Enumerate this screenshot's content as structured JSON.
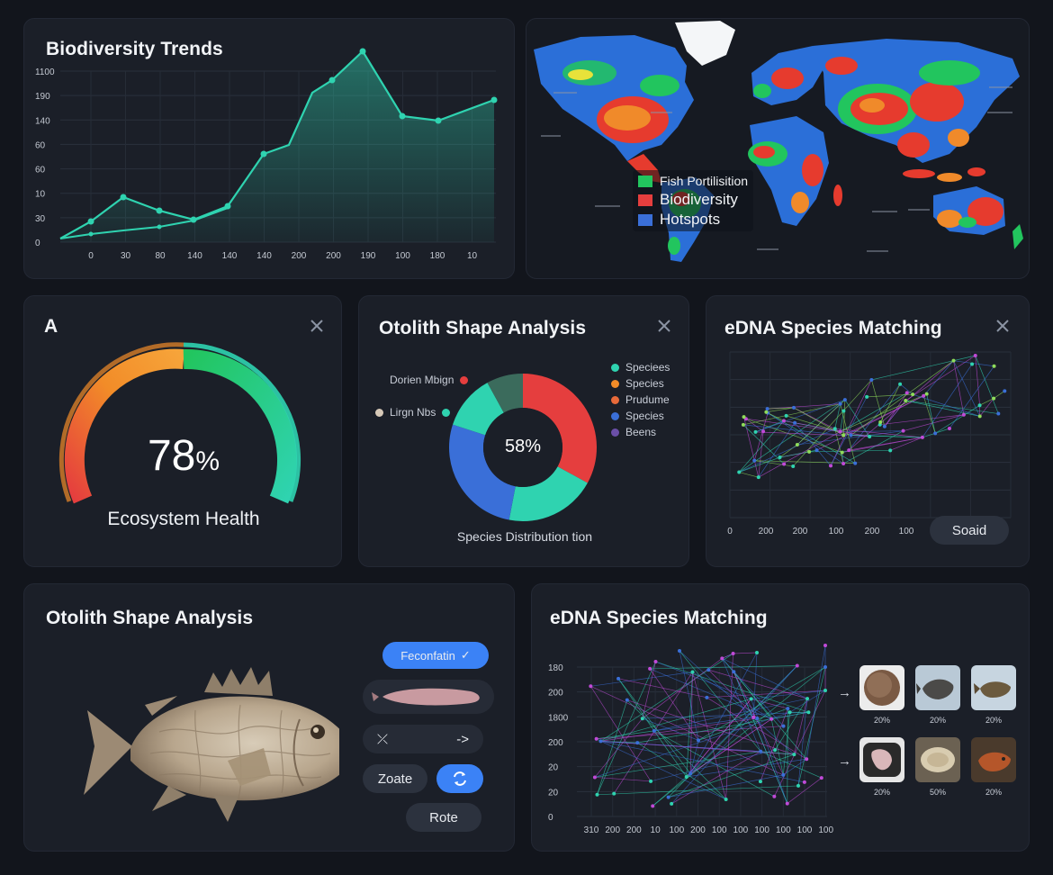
{
  "colors": {
    "background": "#12151c",
    "panel": "#1b1f28",
    "teal": "#2fd3b0",
    "green": "#22c55e",
    "red": "#e53e3e",
    "blue": "#3a6fd8",
    "orange": "#f28c28",
    "accent_button": "#3b82f6"
  },
  "trends": {
    "title": "Biodiversity Trends",
    "chart_data": {
      "type": "line",
      "y_ticks": [
        "1100",
        "190",
        "140",
        "60",
        "60",
        "10",
        "30",
        "0"
      ],
      "x_ticks": [
        "0",
        "30",
        "80",
        "140",
        "140",
        "140",
        "200",
        "200",
        "190",
        "100",
        "180",
        "10"
      ]
    }
  },
  "map": {
    "legend": [
      {
        "label": "Fish Portilisition",
        "color": "#22c55e"
      },
      {
        "label": "Biodiversity",
        "color": "#e53e3e"
      },
      {
        "label": "Hotspots",
        "color": "#3a6fd8"
      }
    ]
  },
  "health": {
    "title": "A",
    "value": "78",
    "unit": "%",
    "label": "Ecosystem Health",
    "gauge_fraction": 0.78
  },
  "otolith_donut": {
    "title": "Otolith Shape Analysis",
    "center_value": "58%",
    "caption": "Species Distribution tion",
    "left_labels": [
      {
        "label": "Dorien Mbign",
        "color": "#e53e3e"
      },
      {
        "label": "Lirgn Nbs",
        "color": "#2fd3b0"
      }
    ],
    "legend": [
      {
        "label": "Speciees",
        "color": "#2fd3b0"
      },
      {
        "label": "Species",
        "color": "#f28c28"
      },
      {
        "label": "Prudume",
        "color": "#e86a3a"
      },
      {
        "label": "Species",
        "color": "#3a6fd8"
      },
      {
        "label": "Beens",
        "color": "#6b4fa8"
      }
    ],
    "chart_data": {
      "type": "pie",
      "slices": [
        {
          "name": "red",
          "value": 33,
          "color": "#e53e3e"
        },
        {
          "name": "teal-lower",
          "value": 20,
          "color": "#2fd3b0"
        },
        {
          "name": "blue",
          "value": 27,
          "color": "#3a6fd8"
        },
        {
          "name": "teal-upper",
          "value": 12,
          "color": "#2fd3b0"
        },
        {
          "name": "dark-green",
          "value": 8,
          "color": "#3b6b5c"
        }
      ]
    }
  },
  "edna_top": {
    "title": "eDNA Species Matching",
    "x_ticks": [
      "0",
      "200",
      "200",
      "100",
      "200",
      "100"
    ],
    "button": "Soaid"
  },
  "otolith_fish": {
    "title": "Otolith Shape Analysis",
    "primary_button": "Feconfatin",
    "swap_left": "⤫",
    "swap_right": "->",
    "zoom_button": "Zoate",
    "rotate_button": "Rote"
  },
  "edna_bottom": {
    "title": "eDNA Species Matching",
    "y_ticks": [
      "180",
      "200",
      "1800",
      "200",
      "20",
      "20",
      "0"
    ],
    "x_ticks": [
      "310",
      "200",
      "200",
      "10",
      "100",
      "200",
      "100",
      "100",
      "100",
      "100",
      "100",
      "100"
    ],
    "matches": [
      {
        "label": "20%"
      },
      {
        "label": "20%"
      },
      {
        "label": "20%"
      },
      {
        "label": "20%"
      },
      {
        "label": "50%"
      },
      {
        "label": "20%"
      }
    ]
  }
}
